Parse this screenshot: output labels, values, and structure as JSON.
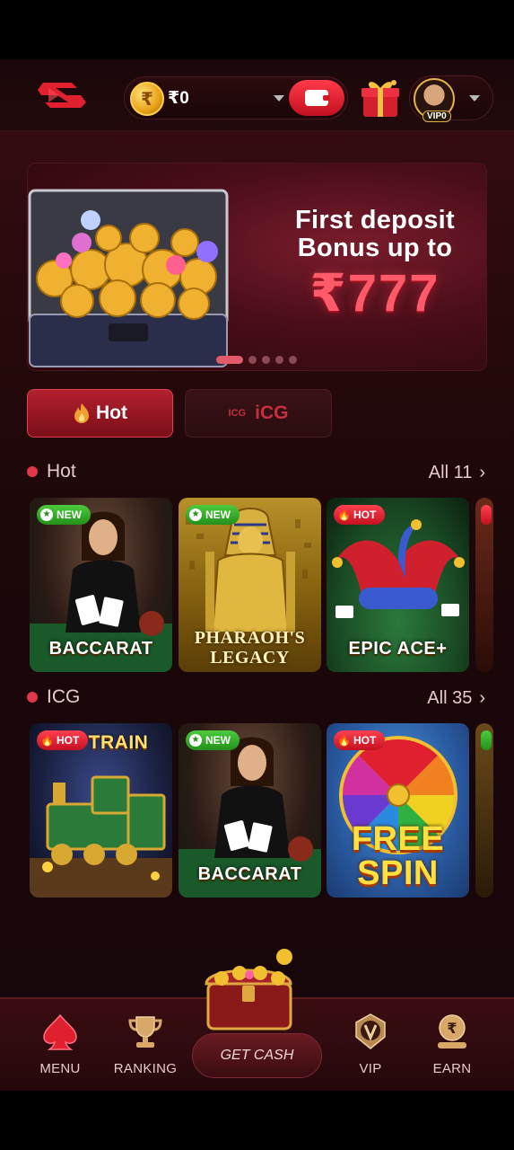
{
  "header": {
    "balance": "₹0",
    "coin_symbol": "₹",
    "vip_label": "VIP0"
  },
  "banner": {
    "line1": "First deposit",
    "line2": "Bonus up to",
    "amount": "₹777",
    "slide_count": 5,
    "active_slide": 1
  },
  "tabs": [
    {
      "label": "Hot",
      "icon": "flame-icon",
      "active": true
    },
    {
      "label": "iCG",
      "prefix": "ICG",
      "active": false
    }
  ],
  "sections": [
    {
      "title": "Hot",
      "all_label": "All 11",
      "games": [
        {
          "label": "BACCARAT",
          "badge": "NEW"
        },
        {
          "label": "PHARAOH'S LEGACY",
          "label_line1": "PHARAOH'S",
          "label_line2": "LEGACY",
          "badge": "NEW"
        },
        {
          "label": "EPIC ACE+",
          "badge": "HOT"
        }
      ]
    },
    {
      "title": "ICG",
      "all_label": "All 35",
      "games": [
        {
          "label": "TRAIN",
          "badge": "HOT"
        },
        {
          "label": "BACCARAT",
          "badge": "NEW"
        },
        {
          "label": "FREE SPIN",
          "label_line1": "FREE",
          "label_line2": "SPIN",
          "badge": "HOT"
        }
      ]
    }
  ],
  "bottom_nav": {
    "menu": "MENU",
    "ranking": "RANKING",
    "get_cash": "GET CASH",
    "vip": "VIP",
    "earn": "EARN"
  },
  "colors": {
    "accent": "#e0384a",
    "background": "#1c0709",
    "gold": "#e7a218"
  }
}
